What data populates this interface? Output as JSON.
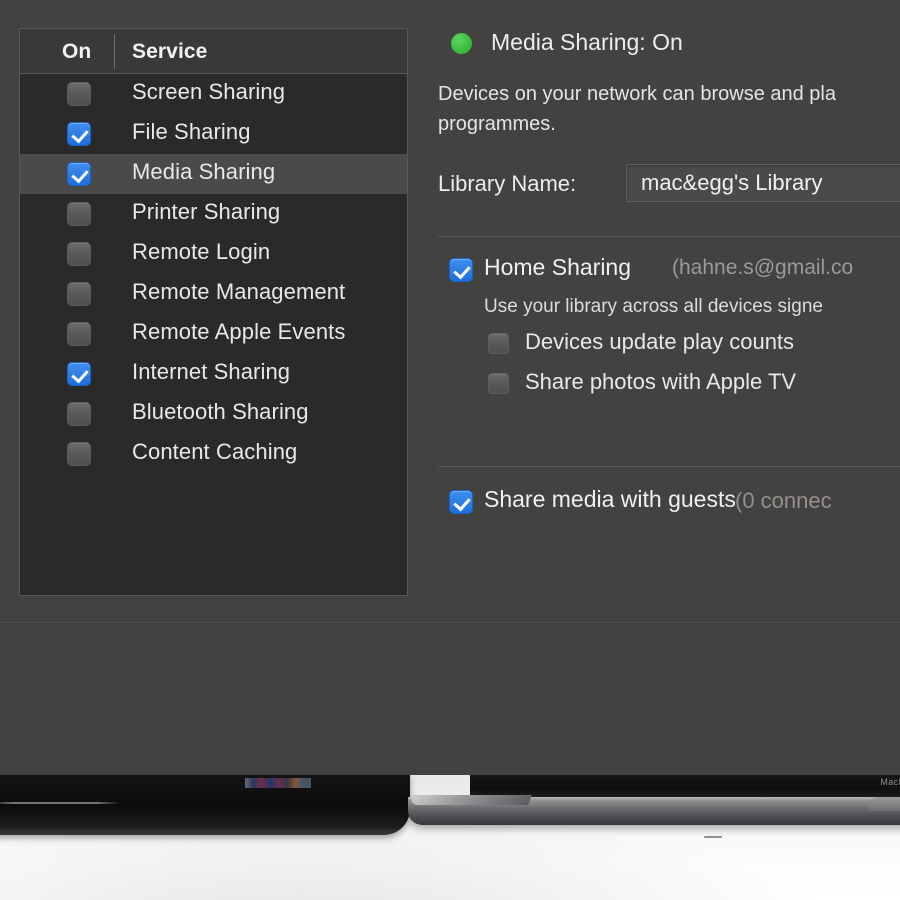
{
  "services_table": {
    "columns": {
      "on": "On",
      "service": "Service"
    },
    "rows": [
      {
        "label": "Screen Sharing",
        "checked": false,
        "selected": false
      },
      {
        "label": "File Sharing",
        "checked": true,
        "selected": false
      },
      {
        "label": "Media Sharing",
        "checked": true,
        "selected": true
      },
      {
        "label": "Printer Sharing",
        "checked": false,
        "selected": false
      },
      {
        "label": "Remote Login",
        "checked": false,
        "selected": false
      },
      {
        "label": "Remote Management",
        "checked": false,
        "selected": false
      },
      {
        "label": "Remote Apple Events",
        "checked": false,
        "selected": false
      },
      {
        "label": "Internet Sharing",
        "checked": true,
        "selected": false
      },
      {
        "label": "Bluetooth Sharing",
        "checked": false,
        "selected": false
      },
      {
        "label": "Content Caching",
        "checked": false,
        "selected": false
      }
    ]
  },
  "detail": {
    "status_indicator": "green-status-dot",
    "status_color": "#38bf3d",
    "status_text": "Media Sharing: On",
    "description": "Devices on your network can browse and pla\nprogrammes.",
    "library_name_label": "Library Name:",
    "library_name_value": "mac&egg's Library",
    "home_sharing": {
      "checked": true,
      "label": "Home Sharing",
      "account": "(hahne.s@gmail.co",
      "sub_description": "Use your library across all devices signe",
      "options": [
        {
          "label": "Devices update play counts",
          "checked": false
        },
        {
          "label": "Share photos with Apple TV",
          "checked": false
        }
      ]
    },
    "guests": {
      "checked": true,
      "label": "Share media with guests",
      "count": "(0 connec"
    }
  },
  "photo": {
    "macbook_label": "MacBook P"
  },
  "colors": {
    "pane_background": "#434241",
    "table_background": "#2b2a29",
    "table_header_background": "#3a3938",
    "row_selected": "#4b4a49",
    "checkbox_on": "#2577e0",
    "checkbox_off": "#5b5a59",
    "text_primary": "#ececec",
    "text_secondary": "#9b9a99",
    "accent_green": "#38bf3d"
  }
}
